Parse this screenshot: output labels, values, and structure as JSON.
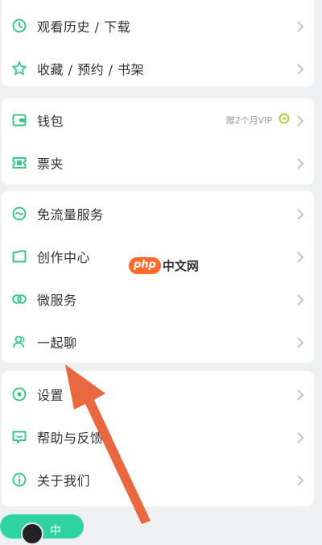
{
  "colors": {
    "icon_green": "#3fc58a",
    "chevron": "#c4c4c4",
    "arrow": "#e9683f",
    "background": "#eef0f2",
    "card": "#ffffff"
  },
  "menu": {
    "group1": [
      {
        "label": "观看历史 / 下载",
        "icon": "clock-icon"
      },
      {
        "label": "收藏 / 预约 / 书架",
        "icon": "star-icon"
      }
    ],
    "group2": [
      {
        "label": "钱包",
        "icon": "wallet-icon",
        "extra": "赠2个月VIP"
      },
      {
        "label": "票夹",
        "icon": "ticket-icon"
      }
    ],
    "group3": [
      {
        "label": "免流量服务",
        "icon": "wave-icon"
      },
      {
        "label": "创作中心",
        "icon": "folder-icon"
      },
      {
        "label": "微服务",
        "icon": "rings-icon"
      },
      {
        "label": "一起聊",
        "icon": "people-icon"
      }
    ],
    "group4": [
      {
        "label": "设置",
        "icon": "gear-icon"
      },
      {
        "label": "帮助与反馈",
        "icon": "chat-icon"
      },
      {
        "label": "关于我们",
        "icon": "info-icon"
      }
    ]
  },
  "watermark": {
    "badge": "php",
    "text": "中文网"
  },
  "bottom_pill": {
    "text": "中"
  }
}
